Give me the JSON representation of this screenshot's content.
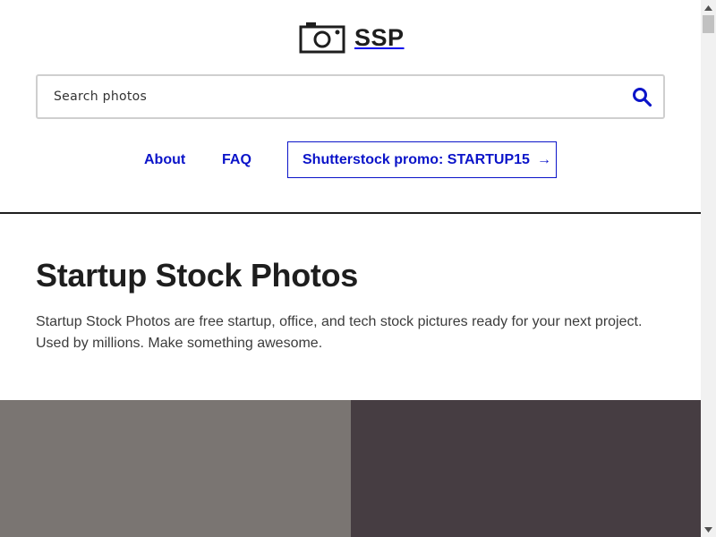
{
  "header": {
    "logo_text": "SSP",
    "logo_icon": "camera-icon",
    "search": {
      "placeholder": "Search photos",
      "value": "",
      "button_icon": "search-icon"
    },
    "nav": {
      "about": "About",
      "faq": "FAQ",
      "promo": "Shutterstock promo: STARTUP15",
      "promo_arrow": "→"
    }
  },
  "intro": {
    "title": "Startup Stock Photos",
    "description": "Startup Stock Photos are free startup, office, and tech stock pictures ready for your next project. Used by millions. Make something awesome."
  },
  "colors": {
    "link": "#0b14c9",
    "text": "#1e1e1e",
    "photo_left": "#7a7572",
    "photo_right": "#463d42"
  }
}
